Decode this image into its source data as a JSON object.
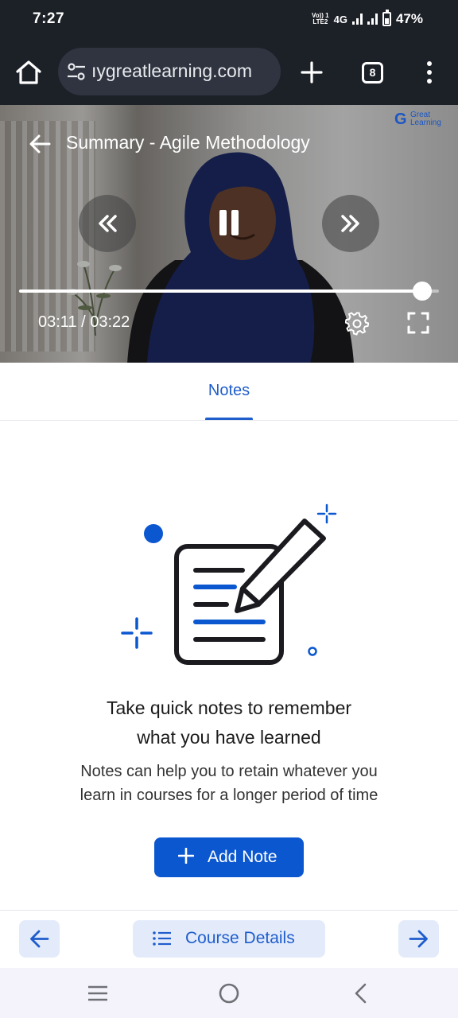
{
  "status_bar": {
    "time": "7:27",
    "volte_line1": "Vo)) 1",
    "volte_line2": "LTE2",
    "network": "4G",
    "battery": "47%"
  },
  "browser": {
    "url": "ıygreatlearning.com",
    "tab_count": "8",
    "icons": [
      "home-icon",
      "tune-icon",
      "plus-icon",
      "tabs-icon",
      "more-vert-icon"
    ]
  },
  "video": {
    "title": "Summary - Agile Methodology",
    "brand_mark": "G",
    "brand_line1": "Great",
    "brand_line2": "Learning",
    "time": "03:11 / 03:22",
    "progress": 0.96,
    "icons": [
      "arrow-back-icon",
      "rewind-icon",
      "pause-icon",
      "fast-forward-icon",
      "settings-icon",
      "fullscreen-icon"
    ]
  },
  "tabs": {
    "notes": "Notes"
  },
  "empty_state": {
    "heading_line1": "Take quick notes to remember",
    "heading_line2": "what you have learned",
    "sub_line1": "Notes can help you to retain whatever you",
    "sub_line2": "learn in courses for a longer period of time",
    "button_label": "Add Note"
  },
  "bottom_nav": {
    "course_details": "Course Details"
  },
  "colors": {
    "accent": "#0b57d0",
    "accent_text": "#1f5dcc",
    "accent_soft": "#e3ebfb",
    "browser_bar": "#1c2027"
  }
}
